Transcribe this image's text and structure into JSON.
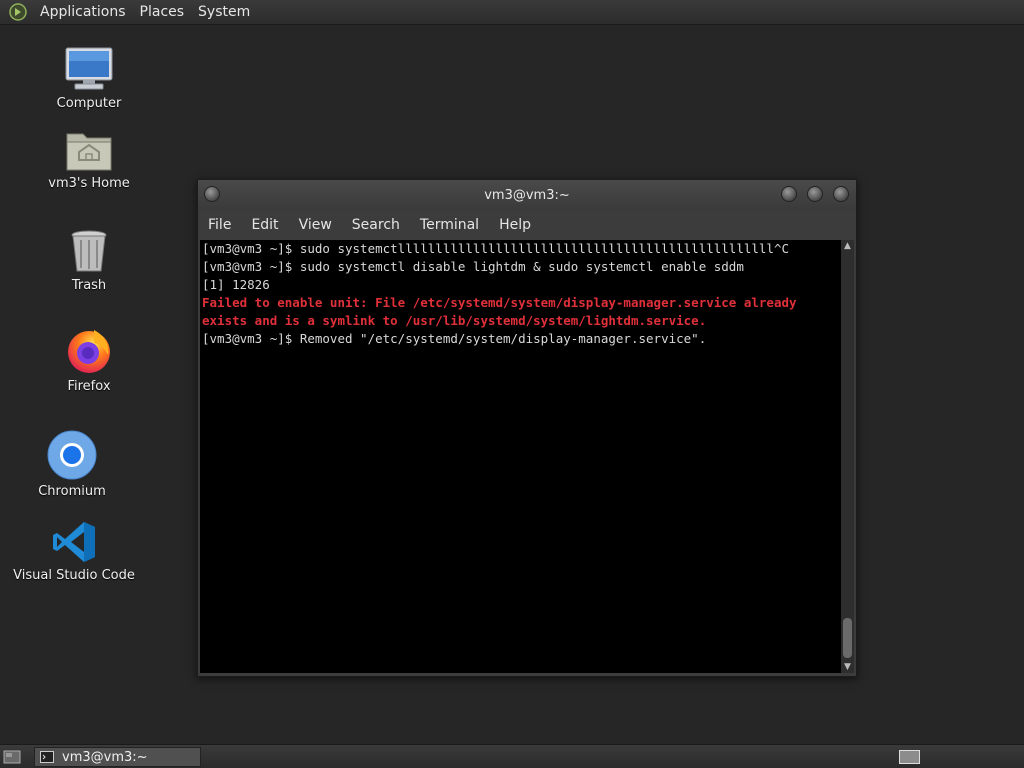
{
  "top_panel": {
    "menus": [
      "Applications",
      "Places",
      "System"
    ]
  },
  "desktop_icons": [
    {
      "label": "Computer",
      "icon": "computer-icon"
    },
    {
      "label": "vm3's Home",
      "icon": "home-folder-icon"
    },
    {
      "label": "Trash",
      "icon": "trash-icon"
    },
    {
      "label": "Firefox",
      "icon": "firefox-icon"
    },
    {
      "label": "Chromium",
      "icon": "chromium-icon"
    },
    {
      "label": "Visual Studio Code",
      "icon": "vscode-icon"
    }
  ],
  "terminal": {
    "title": "vm3@vm3:~",
    "menu": [
      "File",
      "Edit",
      "View",
      "Search",
      "Terminal",
      "Help"
    ],
    "lines": [
      {
        "text": "[vm3@vm3 ~]$ sudo systemctllllllllllllllllllllllllllllllllllllllllllllllllll^C",
        "error": false
      },
      {
        "text": "[vm3@vm3 ~]$ sudo systemctl disable lightdm & sudo systemctl enable sddm",
        "error": false
      },
      {
        "text": "[1] 12826",
        "error": false
      },
      {
        "text": "Failed to enable unit: File /etc/systemd/system/display-manager.service already",
        "error": true
      },
      {
        "text": "exists and is a symlink to /usr/lib/systemd/system/lightdm.service.",
        "error": true
      },
      {
        "text": "[vm3@vm3 ~]$ Removed \"/etc/systemd/system/display-manager.service\".",
        "error": false
      }
    ]
  },
  "taskbar": {
    "window_button": "vm3@vm3:~"
  },
  "colors": {
    "error_text": "#e0303a",
    "terminal_bg": "#000000",
    "desktop_bg": "#262626"
  }
}
